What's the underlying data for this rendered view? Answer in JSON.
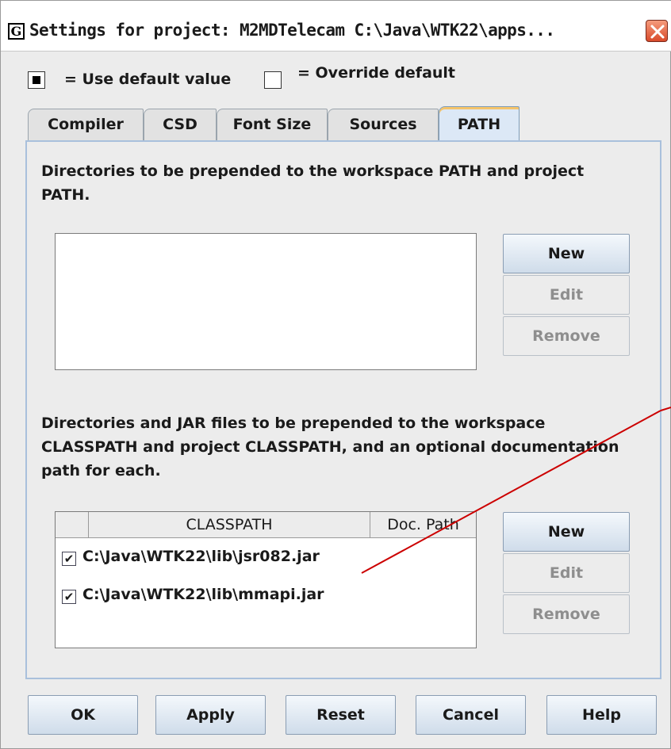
{
  "window": {
    "title": "Settings for project: M2MDTelecam  C:\\Java\\WTK22\\apps...",
    "app_icon_letter": "G"
  },
  "legend": {
    "use_default": "= Use default value",
    "override": "= Override default"
  },
  "tabs": [
    {
      "label": "Compiler",
      "active": false
    },
    {
      "label": "CSD",
      "active": false
    },
    {
      "label": "Font Size",
      "active": false
    },
    {
      "label": "Sources",
      "active": false
    },
    {
      "label": "PATH",
      "active": true
    }
  ],
  "path_section": {
    "description": "Directories to be prepended to the workspace PATH and project PATH.",
    "buttons": {
      "new": "New",
      "edit": "Edit",
      "remove": "Remove"
    },
    "entries": []
  },
  "classpath_section": {
    "description": "Directories and JAR files to be prepended to the workspace CLASSPATH and project CLASSPATH, and an optional documentation path for each.",
    "columns": [
      "",
      "CLASSPATH",
      "Doc. Path"
    ],
    "rows": [
      {
        "checked": true,
        "path": "C:\\Java\\WTK22\\lib\\jsr082.jar",
        "doc_path": ""
      },
      {
        "checked": true,
        "path": "C:\\Java\\WTK22\\lib\\mmapi.jar",
        "doc_path": ""
      }
    ],
    "buttons": {
      "new": "New",
      "edit": "Edit",
      "remove": "Remove"
    }
  },
  "footer_buttons": {
    "ok": "OK",
    "apply": "Apply",
    "reset": "Reset",
    "cancel": "Cancel",
    "help": "Help"
  },
  "colors": {
    "active_tab": "#dce8f6",
    "panel_border": "#a9c0dc",
    "close_button": "#d94a2a",
    "annotation_line": "#cc0000"
  }
}
